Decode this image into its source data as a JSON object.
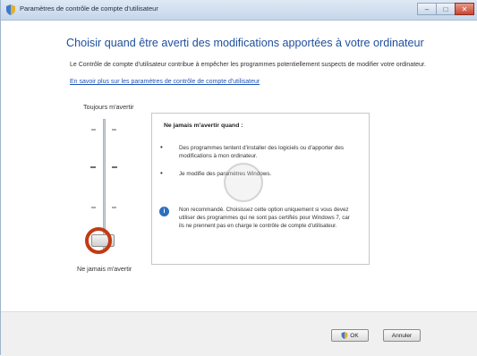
{
  "window": {
    "title": "Paramètres de contrôle de compte d'utilisateur",
    "buttons": {
      "minimize": "–",
      "maximize": "□",
      "close": "✕"
    }
  },
  "header": {
    "heading": "Choisir quand être averti des modifications apportées à votre ordinateur",
    "description": "Le Contrôle de compte d'utilisateur contribue à empêcher les programmes potentiellement suspects de modifier votre ordinateur.",
    "link": "En savoir plus sur les paramètres de contrôle de compte d'utilisateur"
  },
  "slider": {
    "top_label": "Toujours m'avertir",
    "bottom_label": "Ne jamais m'avertir",
    "level": 0
  },
  "info": {
    "title": "Ne jamais m'avertir quand :",
    "bullets": [
      "Des programmes tentent d'installer des logiciels ou d'apporter des modifications à mon ordinateur.",
      "Je modifie des paramètres Windows."
    ],
    "note": "Non recommandé. Choisissez cette option uniquement si vous devez utiliser des programmes qui ne sont pas certifiés pour Windows 7, car ils ne prennent pas en charge le contrôle de compte d'utilisateur."
  },
  "footer": {
    "ok_label": "OK",
    "cancel_label": "Annuler"
  },
  "colors": {
    "heading": "#1e4f9c",
    "link": "#2154b5",
    "highlight_circle": "#c23a14"
  }
}
